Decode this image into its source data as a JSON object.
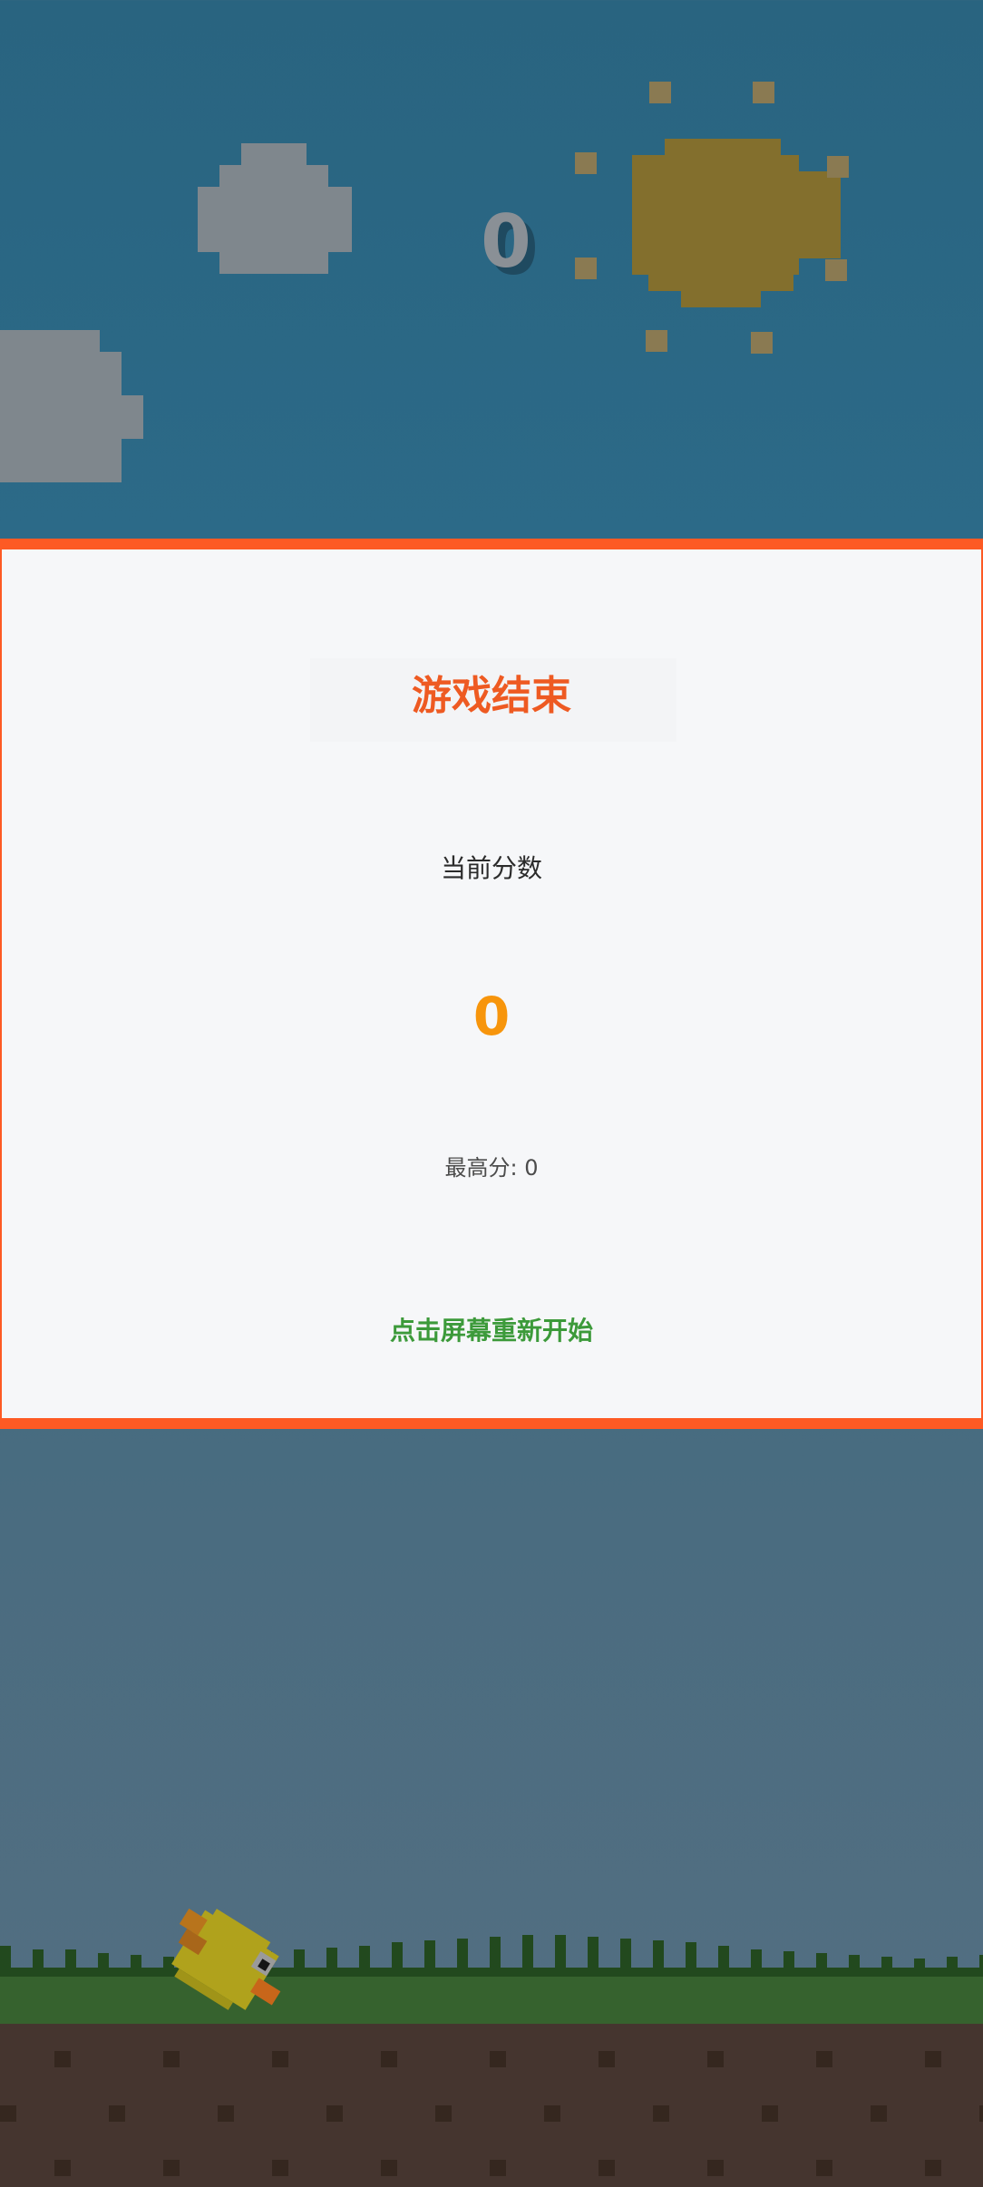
{
  "hud": {
    "score": "0"
  },
  "game_over": {
    "title": "游戏结束",
    "current_score_label": "当前分数",
    "current_score": "0",
    "best_score": "最高分: 0",
    "restart_hint": "点击屏幕重新开始"
  },
  "colors": {
    "sky": "#296480",
    "panel_border": "#fd5a24",
    "title": "#ee5a22",
    "score": "#f7950c",
    "restart": "#3c9a3a",
    "grass": "#36622e",
    "dirt": "#45352f"
  },
  "icons": [
    "cloud-icon",
    "sun-icon",
    "bird-icon"
  ]
}
